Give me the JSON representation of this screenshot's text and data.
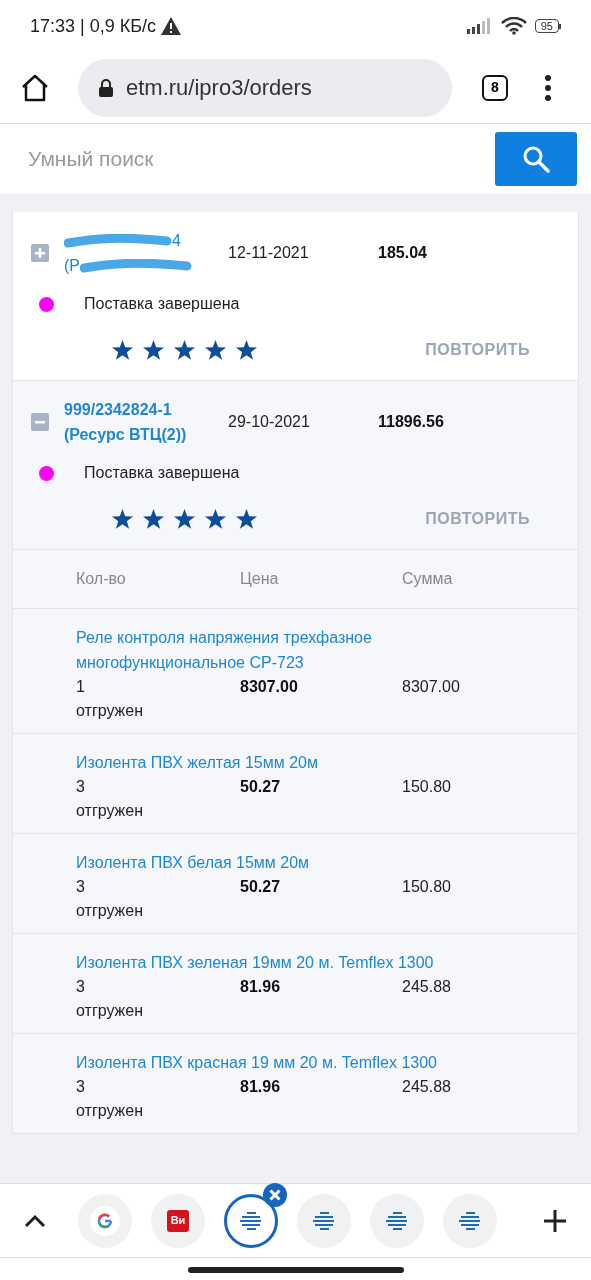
{
  "status_bar": {
    "time_speed": "17:33 | 0,9 КБ/с",
    "battery": "95"
  },
  "browser": {
    "url": "etm.ru/ipro3/orders",
    "tab_count": "8"
  },
  "search": {
    "placeholder": "Умный поиск"
  },
  "orders": [
    {
      "number": "4",
      "store": "(Р",
      "redacted": true,
      "expanded": false,
      "date": "12-11-2021",
      "total": "185.04",
      "status": "Поставка завершена",
      "color": "#ff00ff",
      "stars": 5,
      "repeat": "ПОВТОРИТЬ"
    },
    {
      "number": "999/2342824-1",
      "store": "(Ресурс ВТЦ(2))",
      "redacted": false,
      "expanded": true,
      "date": "29-10-2021",
      "total": "11896.56",
      "status": "Поставка завершена",
      "color": "#ff00ff",
      "stars": 5,
      "repeat": "ПОВТОРИТЬ"
    }
  ],
  "items_table": {
    "columns": [
      "Кол-во",
      "Цена",
      "Сумма"
    ],
    "rows": [
      {
        "name": "Реле контроля напряжения трехфазное многофункциональное CP-723",
        "qty": "1",
        "state": "отгружен",
        "price": "8307.00",
        "sum": "8307.00"
      },
      {
        "name": "Изолента ПВХ желтая 15мм 20м",
        "qty": "3",
        "state": "отгружен",
        "price": "50.27",
        "sum": "150.80"
      },
      {
        "name": "Изолента ПВХ белая 15мм 20м",
        "qty": "3",
        "state": "отгружен",
        "price": "50.27",
        "sum": "150.80"
      },
      {
        "name": "Изолента ПВХ зеленая 19мм 20 м. Temflex 1300",
        "qty": "3",
        "state": "отгружен",
        "price": "81.96",
        "sum": "245.88"
      },
      {
        "name": "Изолента ПВХ красная 19 мм 20 м. Temflex 1300",
        "qty": "3",
        "state": "отгружен",
        "price": "81.96",
        "sum": "245.88"
      }
    ]
  },
  "tab_strip": [
    {
      "kind": "google",
      "selected": false
    },
    {
      "kind": "badge",
      "label": "Ви",
      "selected": false
    },
    {
      "kind": "site",
      "selected": true
    },
    {
      "kind": "site",
      "selected": false
    },
    {
      "kind": "site",
      "selected": false
    },
    {
      "kind": "site",
      "selected": false
    }
  ]
}
